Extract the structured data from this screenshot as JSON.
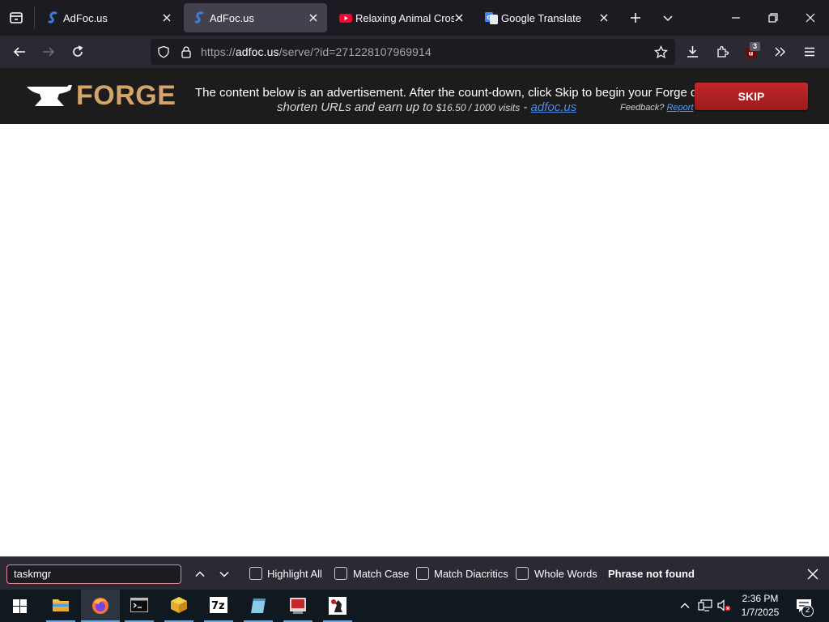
{
  "tabs": [
    {
      "title": "AdFoc.us",
      "favicon": "adfocus-icon",
      "active": false
    },
    {
      "title": "AdFoc.us",
      "favicon": "adfocus-icon",
      "active": true
    },
    {
      "title": "Relaxing Animal Crossi",
      "favicon": "youtube-icon",
      "active": false
    },
    {
      "title": "Google Translate",
      "favicon": "google-translate-icon",
      "active": false
    }
  ],
  "navbar": {
    "url_scheme": "https://",
    "url_host": "adfoc.us",
    "url_path": "/serve/?id=271228107969914",
    "ublock_badge": "3"
  },
  "banner": {
    "logo_text": "FORGE",
    "message": "The content below is an advertisement. After the count-down, click Skip to begin your Forge download.",
    "sub_prefix": "shorten URLs and earn up to ",
    "sub_amount": "$16.50 / 1000 visits",
    "sub_dash": " - ",
    "sub_link": "adfoc.us",
    "feedback_label": "Feedback? ",
    "feedback_link": "Report",
    "skip_label": "SKIP"
  },
  "findbar": {
    "query": "taskmgr",
    "highlight_all": "Highlight All",
    "match_case": "Match Case",
    "match_diacritics": "Match Diacritics",
    "whole_words": "Whole Words",
    "status": "Phrase not found"
  },
  "taskbar": {
    "apps": [
      "file-explorer-icon",
      "firefox-icon",
      "terminal-icon",
      "package-icon",
      "7zip-icon",
      "notepad-icon",
      "media-player-icon",
      "chess-icon"
    ],
    "time": "2:36 PM",
    "date": "1/7/2025",
    "notification_count": "2"
  },
  "colors": {
    "accent": "#c1282a",
    "forge_gold": "#d5a46a",
    "link": "#4a8be8",
    "tab_active": "#42414d",
    "chrome_bg": "#1c1b22"
  }
}
